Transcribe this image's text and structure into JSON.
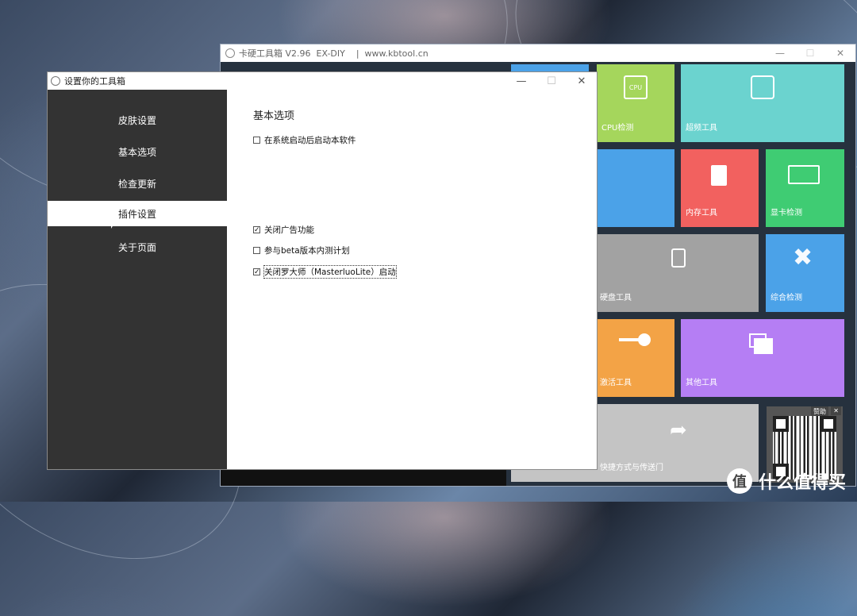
{
  "main_window": {
    "title": "卡硬工具箱 V2.96  EX-DIY    |  www.kbtool.cn",
    "controls": {
      "minimize": "—",
      "maximize": "☐",
      "close": "✕"
    }
  },
  "tiles": [
    {
      "label": "CPU检测",
      "color": "#a5d65c",
      "icon": "cpu-icon",
      "glyph": "▣"
    },
    {
      "label": "超频工具",
      "color": "#6bd3cf",
      "icon": "sliders-icon",
      "glyph": "☰"
    },
    {
      "label": "",
      "color": "#4ba2e8",
      "icon": "monitor-icon",
      "glyph": ""
    },
    {
      "label": "内存工具",
      "color": "#f2615f",
      "icon": "memory-card-icon",
      "glyph": "▮"
    },
    {
      "label": "显卡检测",
      "color": "#3fcc73",
      "icon": "gpu-card-icon",
      "glyph": "▭"
    },
    {
      "label": "硬盘工具",
      "color": "#a2a2a2",
      "icon": "disk-icon",
      "glyph": "⛁"
    },
    {
      "label": "综合检测",
      "color": "#4ba2e8",
      "icon": "tools-icon",
      "glyph": "✖"
    },
    {
      "label": "激活工具",
      "color": "#f3a346",
      "icon": "key-icon",
      "glyph": "⚿"
    },
    {
      "label": "其他工具",
      "color": "#b57ef4",
      "icon": "windows-stack-icon",
      "glyph": "❐"
    },
    {
      "label": "快捷方式与传送门",
      "color": "#c4c4c4",
      "icon": "share-arrow-icon",
      "glyph": "➦"
    }
  ],
  "qr_ad": {
    "label": "赞助",
    "close": "✕"
  },
  "dialog": {
    "title": "设置你的工具箱",
    "controls": {
      "minimize": "—",
      "maximize": "☐",
      "close": "✕"
    },
    "sidebar": [
      {
        "label": "皮肤设置",
        "active": false
      },
      {
        "label": "基本选项",
        "active": false
      },
      {
        "label": "检查更新",
        "active": false
      },
      {
        "label": "插件设置",
        "active": true
      },
      {
        "label": "关于页面",
        "active": false
      }
    ],
    "section_title": "基本选项",
    "options": [
      {
        "label": "在系统启动后启动本软件",
        "checked": false
      },
      {
        "label": "关闭广告功能",
        "checked": true
      },
      {
        "label": "参与beta版本内测计划",
        "checked": false
      },
      {
        "label": "关闭罗大师（MasterluoLite）启动",
        "checked": true
      }
    ]
  },
  "watermark": {
    "text": "什么值得买",
    "logo": "值"
  }
}
